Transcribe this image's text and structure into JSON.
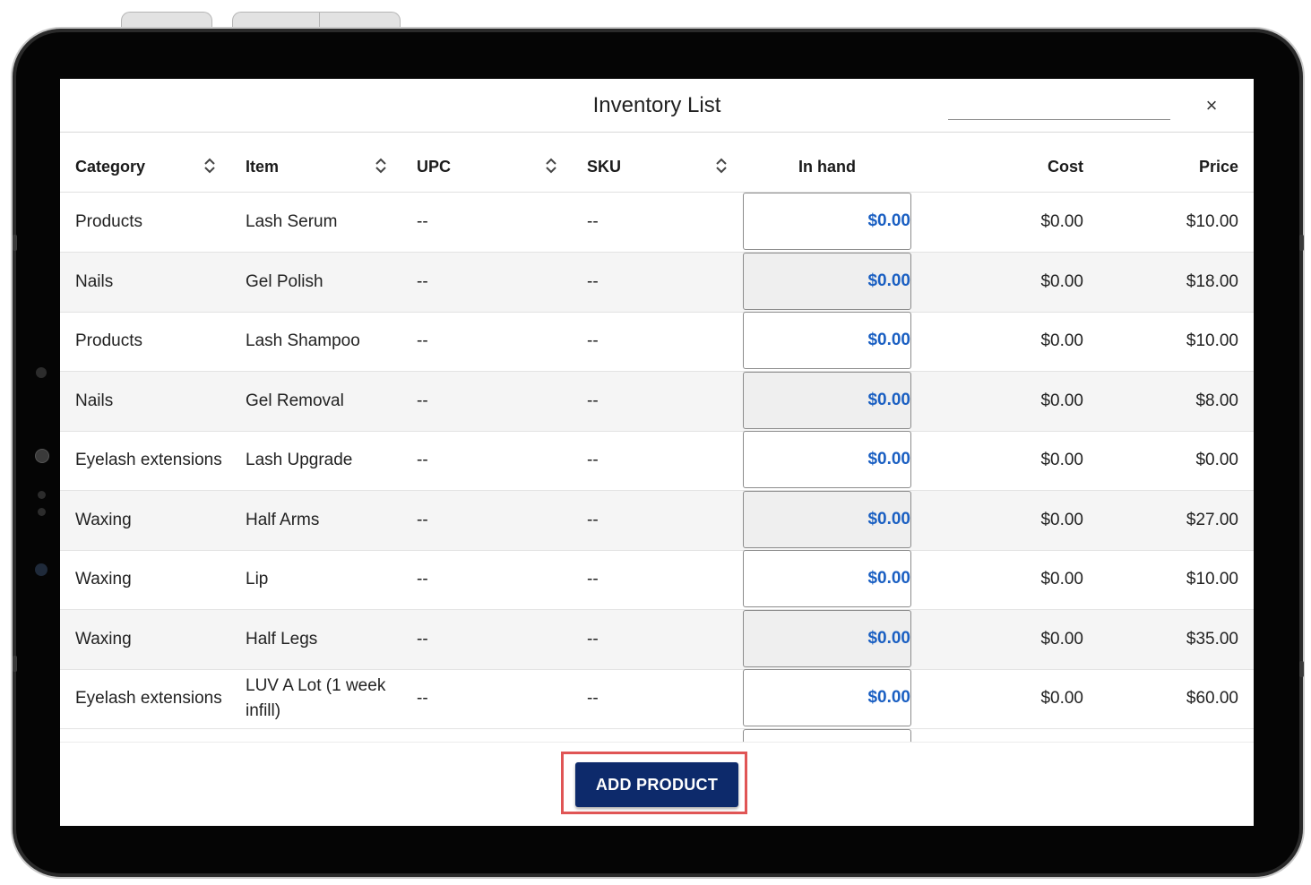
{
  "window": {
    "title": "Inventory List",
    "close_glyph": "×"
  },
  "table": {
    "headers": [
      "Category",
      "Item",
      "UPC",
      "SKU",
      "In hand",
      "Cost",
      "Price"
    ],
    "rows": [
      {
        "category": "Products",
        "item": "Lash Serum",
        "upc": "--",
        "sku": "--",
        "in_hand": "$0.00",
        "cost": "$0.00",
        "price": "$10.00"
      },
      {
        "category": "Nails",
        "item": "Gel Polish",
        "upc": "--",
        "sku": "--",
        "in_hand": "$0.00",
        "cost": "$0.00",
        "price": "$18.00"
      },
      {
        "category": "Products",
        "item": "Lash Shampoo",
        "upc": "--",
        "sku": "--",
        "in_hand": "$0.00",
        "cost": "$0.00",
        "price": "$10.00"
      },
      {
        "category": "Nails",
        "item": "Gel Removal",
        "upc": "--",
        "sku": "--",
        "in_hand": "$0.00",
        "cost": "$0.00",
        "price": "$8.00"
      },
      {
        "category": "Eyelash extensions",
        "item": "Lash Upgrade",
        "upc": "--",
        "sku": "--",
        "in_hand": "$0.00",
        "cost": "$0.00",
        "price": "$0.00"
      },
      {
        "category": "Waxing",
        "item": "Half Arms",
        "upc": "--",
        "sku": "--",
        "in_hand": "$0.00",
        "cost": "$0.00",
        "price": "$27.00"
      },
      {
        "category": "Waxing",
        "item": "Lip",
        "upc": "--",
        "sku": "--",
        "in_hand": "$0.00",
        "cost": "$0.00",
        "price": "$10.00"
      },
      {
        "category": "Waxing",
        "item": "Half Legs",
        "upc": "--",
        "sku": "--",
        "in_hand": "$0.00",
        "cost": "$0.00",
        "price": "$35.00"
      },
      {
        "category": "Eyelash extensions",
        "item": "LUV A Lot (1 week infill)",
        "upc": "--",
        "sku": "--",
        "in_hand": "$0.00",
        "cost": "$0.00",
        "price": "$60.00"
      }
    ]
  },
  "footer": {
    "add_product_label": "ADD PRODUCT"
  },
  "colors": {
    "accent": "#0d2a6b",
    "in_hand_text": "#1a5fc2",
    "highlight": "#e05555"
  },
  "icons": {
    "sort": "sort-icon",
    "close": "close-icon"
  }
}
